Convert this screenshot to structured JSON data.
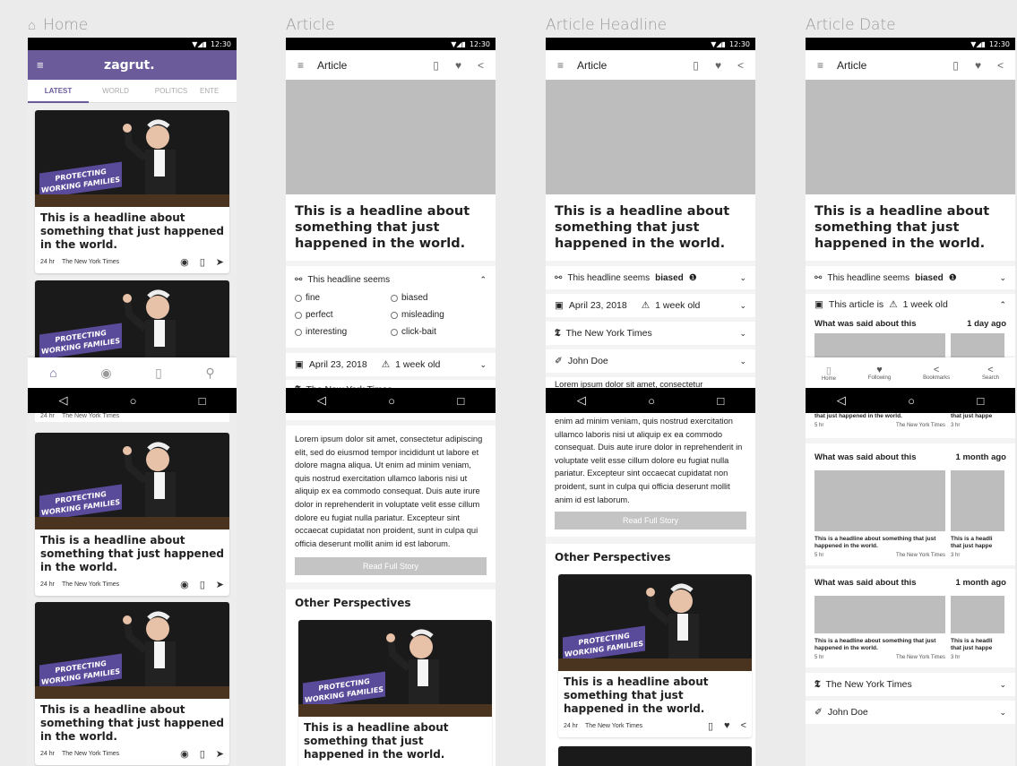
{
  "columns": {
    "home": "Home",
    "article": "Article",
    "headline": "Article Headline",
    "date": "Article Date"
  },
  "status_time": "12:30",
  "home": {
    "brand": "zagrut.",
    "tabs": [
      "LATEST",
      "WORLD",
      "POLITICS",
      "ENTE"
    ],
    "banner_text": "PROTECTING WORKING FAMILIES",
    "card_headline": "This is a headline about something that just happened in the world.",
    "card_time": "24 hr",
    "card_source": "The New York Times",
    "partial_time": "24 hr",
    "partial_source": "The New York Times",
    "brand_color": "#6b5b9a"
  },
  "article": {
    "title": "Article",
    "headline": "This is a headline about something that just happened in the world.",
    "seems_label": "This headline seems",
    "seems_value": "biased",
    "options_left": [
      "fine",
      "perfect",
      "interesting"
    ],
    "options_right": [
      "biased",
      "misleading",
      "click-bait"
    ],
    "date": "April 23, 2018",
    "age": "1 week old",
    "source": "The New York Times",
    "author": "John Doe",
    "body": "Lorem ipsum dolor sit amet, consectetur adipiscing elit, sed do eiusmod tempor incididunt ut labore et dolore magna aliqua. Ut enim ad minim veniam, quis nostrud exercitation ullamco laboris nisi ut aliquip ex ea commodo consequat. Duis aute irure dolor in reprehenderit in voluptate velit esse cillum dolore eu fugiat nulla pariatur. Excepteur sint occaecat cupidatat non proident, sunt in culpa qui officia deserunt mollit anim id est laborum.",
    "body_first_line": "Lorem ipsum dolor sit amet, consectetur",
    "body_tail": "enim ad minim veniam, quis nostrud exercitation ullamco laboris nisi ut aliquip ex ea commodo consequat. Duis aute irure dolor in reprehenderit in voluptate velit esse cillum dolore eu fugiat nulla pariatur. Excepteur sint occaecat cupidatat non proident, sunt in culpa qui officia deserunt mollit anim id est laborum.",
    "read_full": "Read Full Story",
    "other_perspectives": "Other Perspectives",
    "op_headline": "This is a headline about something that just happened in the world.",
    "op_time": "24 hr",
    "op_source": "The New York Times"
  },
  "date_screen": {
    "article_is": "This article is",
    "age": "1 week old",
    "said_label": "What was said about this",
    "said_1_age": "1 day ago",
    "said_2_age": "1 month ago",
    "said_3_age": "1 month ago",
    "thumb_headline": "This is a headline about something that just happened in the world.",
    "thumb_headline_cut": "This is a headli that just happe",
    "thumb_headline_first": "that just happened in the world.",
    "thumb_headline_first_cut": "that just happe",
    "thumb_time": "5 hr",
    "thumb_source": "The New York Times",
    "thumb_time_2": "3 hr",
    "source": "The New York Times",
    "author": "John Doe",
    "nav": [
      "Home",
      "Following",
      "Bookmarks",
      "Search"
    ]
  }
}
